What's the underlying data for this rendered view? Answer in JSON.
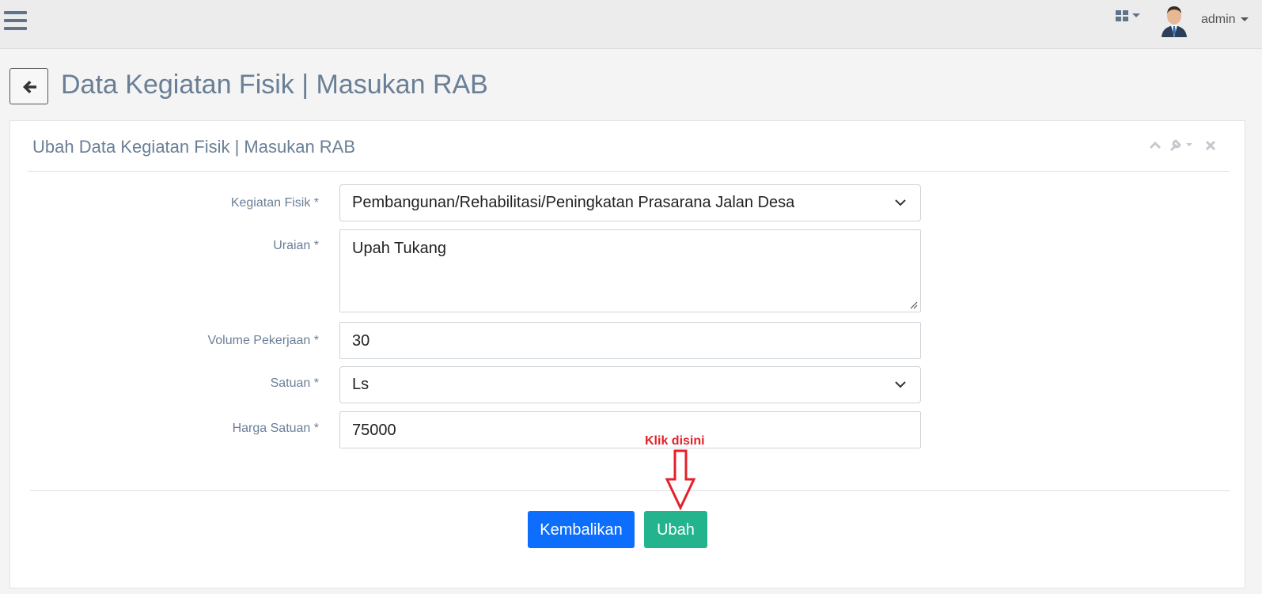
{
  "topbar": {
    "user_name": "admin",
    "icons": {
      "menu": "hamburger-icon",
      "apps": "grid-icon",
      "avatar": "user-avatar"
    }
  },
  "page": {
    "title": "Data Kegiatan Fisik | Masukan RAB",
    "back_icon": "arrow-left-icon"
  },
  "panel": {
    "title": "Ubah Data Kegiatan Fisik | Masukan RAB",
    "tools": [
      "chevron-up-icon",
      "wrench-icon",
      "close-icon"
    ]
  },
  "form": {
    "kegiatan_fisik": {
      "label": "Kegiatan Fisik *",
      "value": "Pembangunan/Rehabilitasi/Peningkatan Prasarana Jalan Desa"
    },
    "uraian": {
      "label": "Uraian *",
      "value": "Upah Tukang"
    },
    "volume": {
      "label": "Volume Pekerjaan *",
      "value": "30"
    },
    "satuan": {
      "label": "Satuan *",
      "value": "Ls"
    },
    "harga": {
      "label": "Harga Satuan *",
      "value": "75000"
    }
  },
  "actions": {
    "kembalikan_label": "Kembalikan",
    "ubah_label": "Ubah"
  },
  "annotation": {
    "text": "Klik disini"
  },
  "colors": {
    "primary": "#0d6efd",
    "success": "#23b48e",
    "annotation": "#e5202a",
    "title": "#6a7f96"
  }
}
